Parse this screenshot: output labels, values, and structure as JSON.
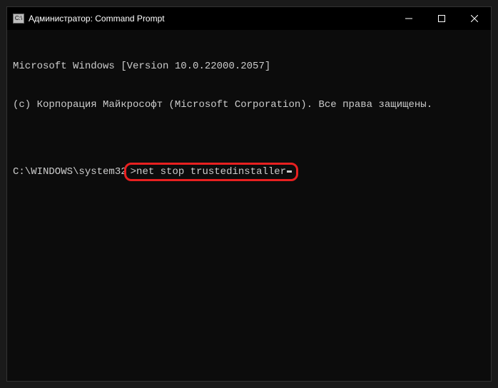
{
  "window": {
    "title": "Администратор: Command Prompt",
    "icon_label": "cmd"
  },
  "terminal": {
    "line1": "Microsoft Windows [Version 10.0.22000.2057]",
    "line2": "(c) Корпорация Майкрософт (Microsoft Corporation). Все права защищены.",
    "blank": "",
    "prompt_path": "C:\\WINDOWS\\system32",
    "prompt_symbol": ">",
    "command": "net stop trustedinstaller"
  }
}
